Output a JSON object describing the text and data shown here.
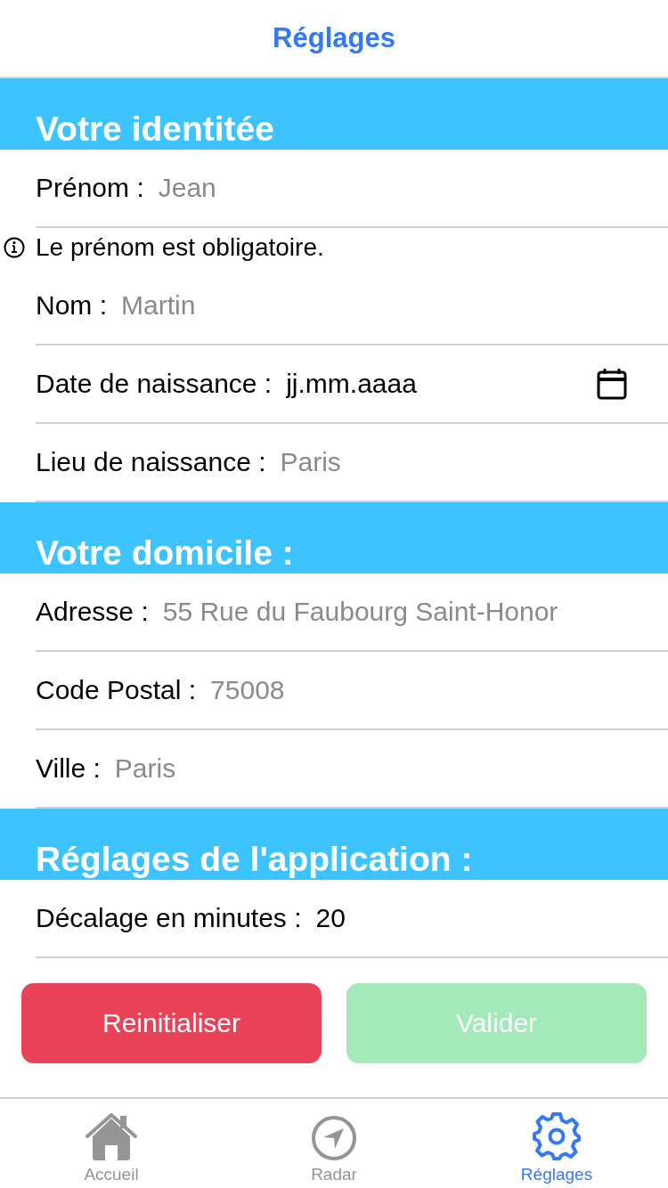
{
  "header": {
    "title": "Réglages"
  },
  "sections": [
    {
      "title": "Votre identitée",
      "fields": [
        {
          "kind": "text",
          "label": "Prénom :",
          "placeholder": "Jean",
          "error": "Le prénom est obligatoire."
        },
        {
          "kind": "text",
          "label": "Nom :",
          "placeholder": "Martin"
        },
        {
          "kind": "date",
          "label": "Date de naissance :",
          "value": "jj.mm.aaaa"
        },
        {
          "kind": "text",
          "label": "Lieu de naissance :",
          "placeholder": "Paris"
        }
      ]
    },
    {
      "title": "Votre domicile :",
      "fields": [
        {
          "kind": "text",
          "label": "Adresse :",
          "placeholder": "55 Rue du Faubourg Saint-Honor"
        },
        {
          "kind": "text",
          "label": "Code Postal :",
          "placeholder": "75008"
        },
        {
          "kind": "text",
          "label": "Ville :",
          "placeholder": "Paris"
        }
      ]
    },
    {
      "title": "Réglages de l'application :",
      "fields": [
        {
          "kind": "text",
          "label": "Décalage en minutes :",
          "value": "20"
        }
      ]
    }
  ],
  "buttons": [
    {
      "kind": "reset",
      "label": "Reinitialiser",
      "disabled": false
    },
    {
      "kind": "submit",
      "label": "Valider",
      "disabled": true
    }
  ],
  "tabs": [
    {
      "kind": "home",
      "label": "Accueil",
      "selected": false
    },
    {
      "kind": "radar",
      "label": "Radar",
      "selected": false
    },
    {
      "kind": "settings",
      "label": "Réglages",
      "selected": true
    }
  ]
}
